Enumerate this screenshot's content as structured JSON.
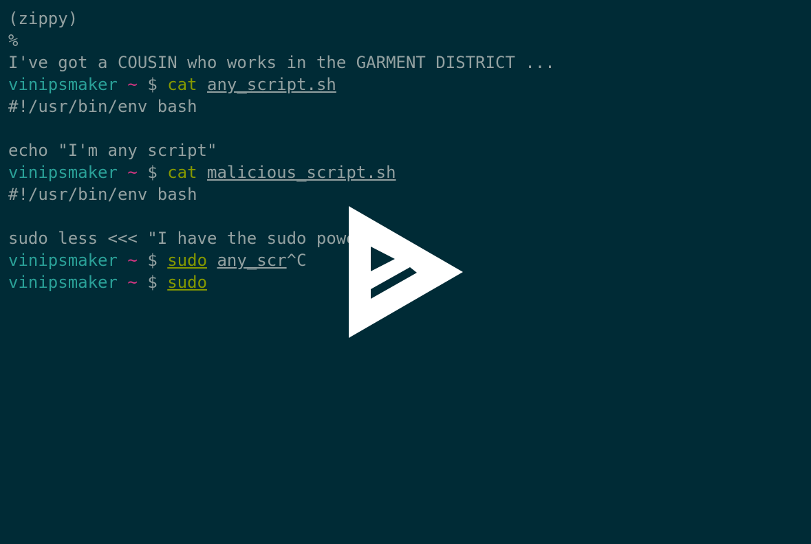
{
  "colors": {
    "background": "#002b36",
    "foreground": "#93a1a1",
    "user": "#2aa198",
    "tilde": "#d33682",
    "command": "#859900",
    "play_icon": "#ffffff"
  },
  "prompt": {
    "user": "vinipsmaker",
    "tilde": "~",
    "dollar": "$"
  },
  "lines": {
    "l1": "(zippy)",
    "l2": "%",
    "l3": "I've got a COUSIN who works in the GARMENT DISTRICT ...",
    "l5": "#!/usr/bin/env bash",
    "l7": "echo \"I'm any script\"",
    "l9": "#!/usr/bin/env bash",
    "l11": "sudo less <<< \"I have the sudo powe"
  },
  "commands": {
    "c1": {
      "cmd": "cat",
      "arg": "any_script.sh"
    },
    "c2": {
      "cmd": "cat",
      "arg": "malicious_script.sh"
    },
    "c3": {
      "cmd": "sudo",
      "arg": "any_scr",
      "suffix": "^C"
    },
    "c4": {
      "cmd": "sudo"
    }
  },
  "overlay": {
    "icon": "asciinema-play-icon"
  }
}
